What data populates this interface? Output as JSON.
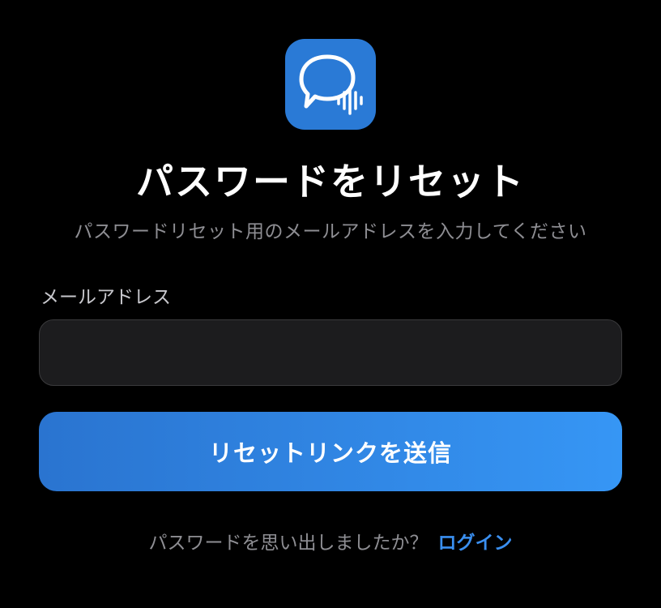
{
  "app_icon": {
    "name": "chat-voice-icon",
    "color": "#2a7ad6"
  },
  "title": "パスワードをリセット",
  "subtitle": "パスワードリセット用のメールアドレスを入力してください",
  "email_field": {
    "label": "メールアドレス",
    "value": "",
    "placeholder": ""
  },
  "submit_button": {
    "label": "リセットリンクを送信",
    "color_start": "#2a74d0",
    "color_end": "#3696f5"
  },
  "footer": {
    "prompt": "パスワードを思い出しましたか？",
    "login_link": "ログイン",
    "link_color": "#3a8ff0"
  }
}
